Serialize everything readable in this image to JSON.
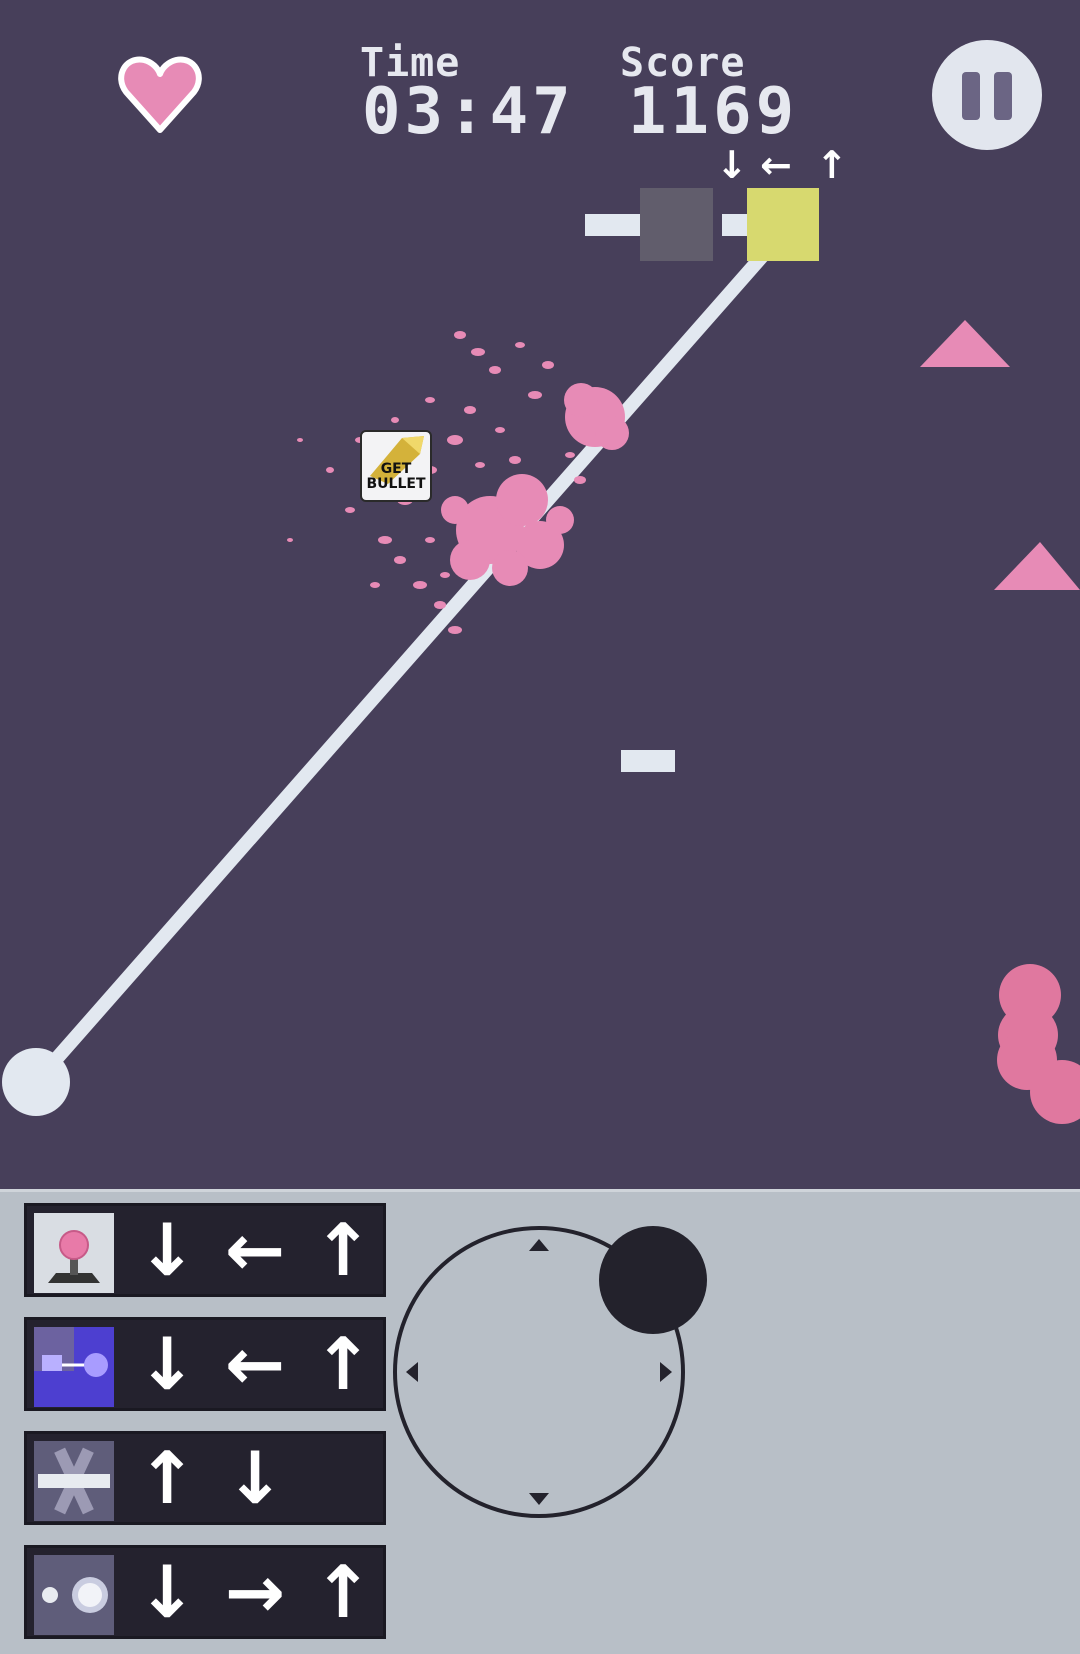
{
  "hud": {
    "lives_icon": "heart-icon",
    "time_label": "Time",
    "time_value": "03:47",
    "score_label": "Score",
    "score_value": "1169",
    "pause_icon": "pause-icon"
  },
  "sequence": {
    "arrows": [
      "↓",
      "←",
      "↑"
    ]
  },
  "pickup": {
    "line1": "GET",
    "line2": "BULLET"
  },
  "colors": {
    "background": "#473f5a",
    "accent_pink": "#e78bb6",
    "rail": "#e2e8f0",
    "active_block": "#d7d96f",
    "inactive_block": "#615d6c",
    "panel": "#b8bfc7",
    "command_row": "#24222e"
  },
  "commands": [
    {
      "icon": "joystick-icon",
      "arrows": [
        "↓",
        "←",
        "↑"
      ]
    },
    {
      "icon": "swing-block-icon",
      "arrows": [
        "↓",
        "←",
        "↑"
      ]
    },
    {
      "icon": "spin-cross-icon",
      "arrows": [
        "↑",
        "↓"
      ]
    },
    {
      "icon": "shot-icon",
      "arrows": [
        "↓",
        "→",
        "↑"
      ]
    }
  ],
  "joystick": {
    "directions": [
      "up",
      "down",
      "left",
      "right"
    ]
  }
}
